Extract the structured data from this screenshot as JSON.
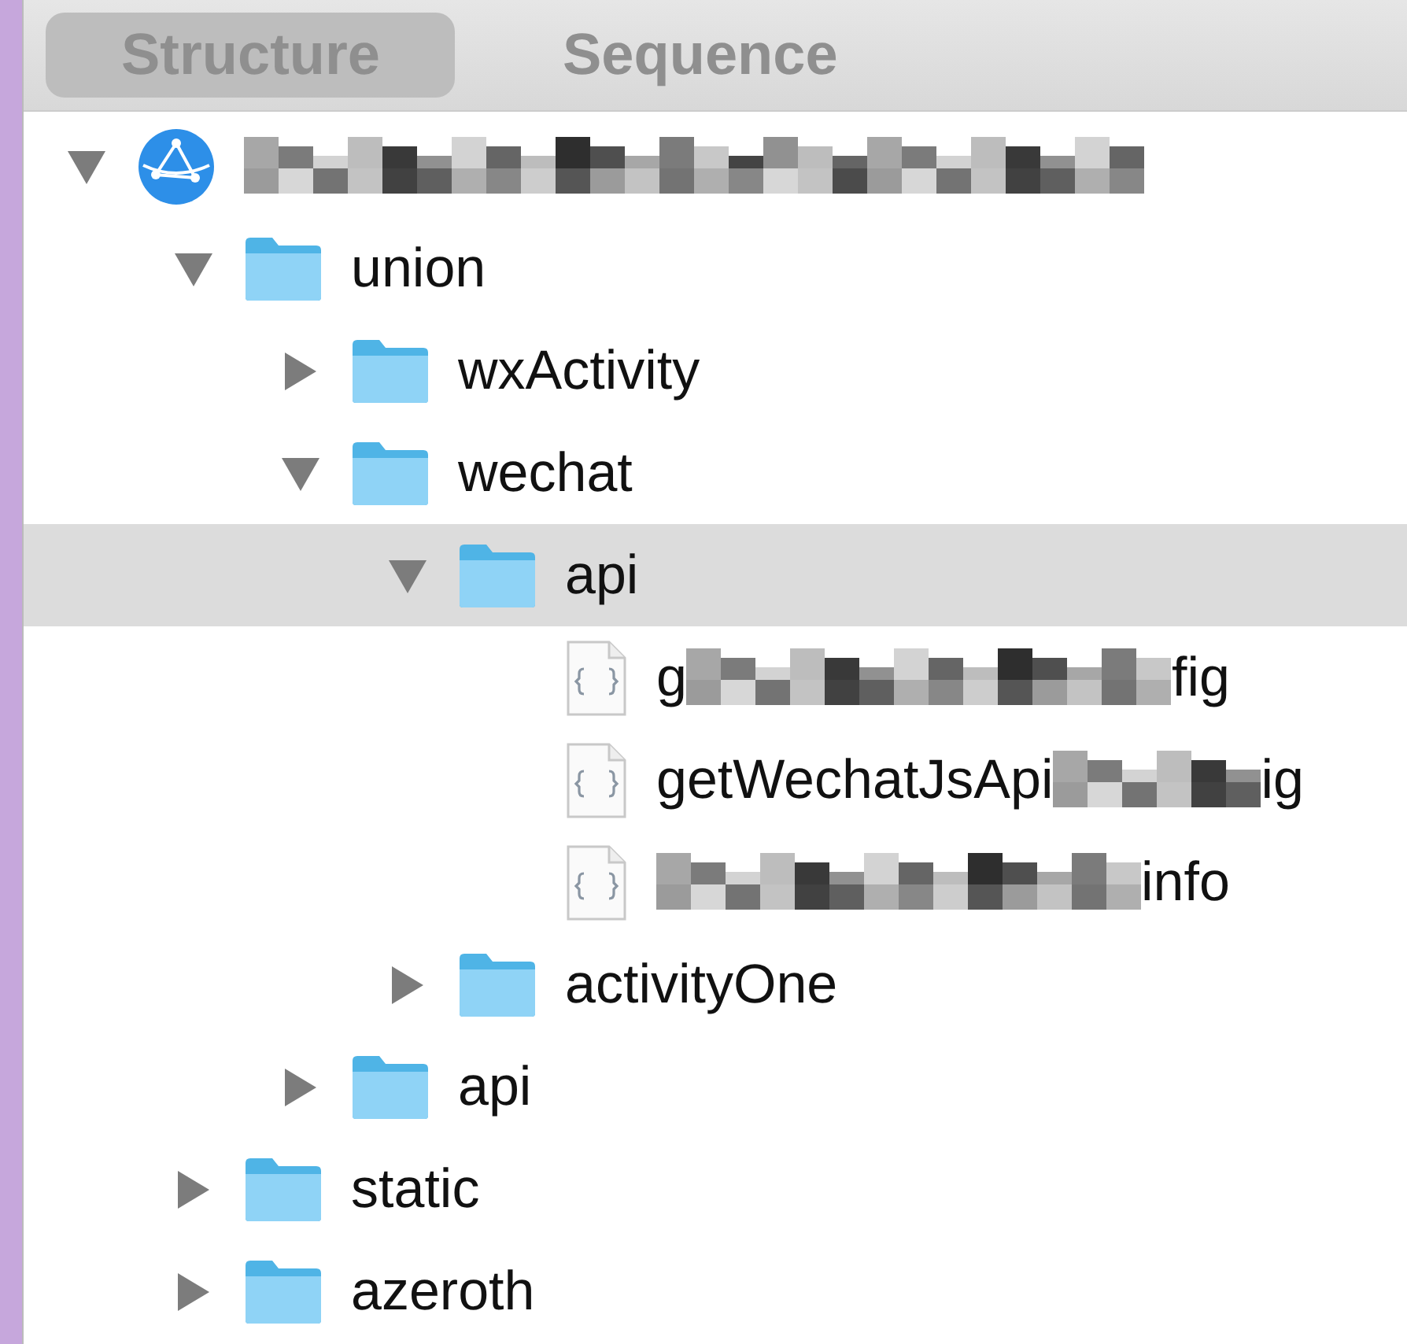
{
  "tabs": [
    {
      "label": "Structure",
      "selected": true
    },
    {
      "label": "Sequence",
      "selected": false
    }
  ],
  "tree": [
    {
      "kind": "host",
      "redacted": true,
      "expanded": true,
      "selected": false,
      "children": [
        {
          "kind": "folder",
          "label": "union",
          "expanded": true,
          "selected": false,
          "children": [
            {
              "kind": "folder",
              "label": "wxActivity",
              "expanded": false,
              "selected": false
            },
            {
              "kind": "folder",
              "label": "wechat",
              "expanded": true,
              "selected": false,
              "children": [
                {
                  "kind": "folder",
                  "label": "api",
                  "expanded": true,
                  "selected": true,
                  "children": [
                    {
                      "kind": "file",
                      "label_start": "g",
                      "label_end": "fig",
                      "redacted": true,
                      "selected": false
                    },
                    {
                      "kind": "file",
                      "label_start": "getWechatJsApi",
                      "label_end": "ig",
                      "redacted": true,
                      "selected": false
                    },
                    {
                      "kind": "file",
                      "label_end": "info",
                      "redacted": true,
                      "selected": false
                    }
                  ]
                },
                {
                  "kind": "folder",
                  "label": "activityOne",
                  "expanded": false,
                  "selected": false
                }
              ]
            },
            {
              "kind": "folder",
              "label": "api",
              "expanded": false,
              "selected": false
            }
          ]
        },
        {
          "kind": "folder",
          "label": "static",
          "expanded": false,
          "selected": false
        },
        {
          "kind": "folder",
          "label": "azeroth",
          "expanded": false,
          "selected": false
        }
      ]
    }
  ]
}
